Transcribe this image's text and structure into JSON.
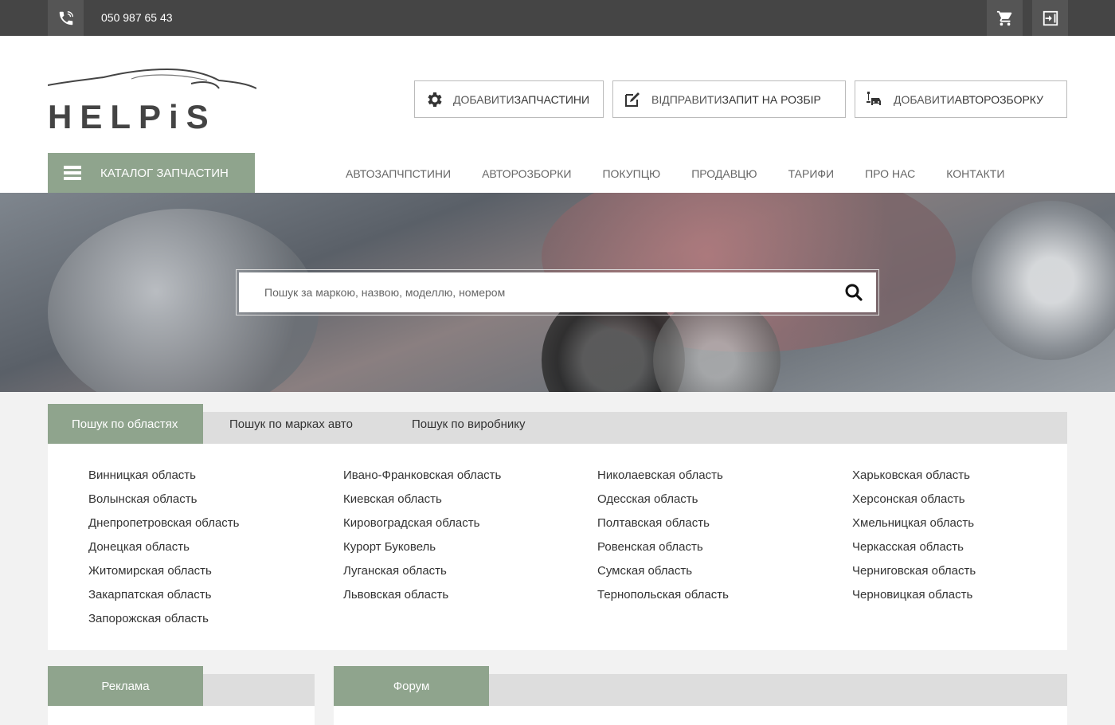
{
  "topbar": {
    "phone": "050 987 65 43",
    "icons": [
      "phone-icon",
      "cart-icon",
      "login-icon"
    ]
  },
  "logo": {
    "text": "HELPiS"
  },
  "actions": [
    {
      "light": "ДОБАВИТИ ",
      "bold": "ЗАПЧАСТИНИ",
      "icon": "gear-icon"
    },
    {
      "light": "ВІДПРАВИТИ ",
      "bold": "ЗАПИТ НА РОЗБІР",
      "icon": "edit-icon"
    },
    {
      "light": "ДОБАВИТИ ",
      "bold": "АВТОРОЗБОРКУ",
      "icon": "car-repair-icon"
    }
  ],
  "catalog": {
    "label": "КАТАЛОГ ЗАПЧАСТИН"
  },
  "nav": [
    "АВТОЗАПЧПСТИНИ",
    "АВТОРОЗБОРКИ",
    "ПОКУПЦЮ",
    "ПРОДАВЦЮ",
    "ТАРИФИ",
    "ПРО НАС",
    "КОНТАКТИ"
  ],
  "search": {
    "placeholder": "Пошук за маркою, назвою, моделлю, номером"
  },
  "tabs": [
    "Пошук по областях",
    "Пошук по марках авто",
    "Пошук по виробнику"
  ],
  "regions": [
    [
      "Винницкая область",
      "Волынская область",
      "Днепропетровская область",
      "Донецкая область",
      "Житомирская область",
      "Закарпатская область",
      "Запорожская область"
    ],
    [
      "Ивано-Франковская область",
      "Киевская область",
      "Кировоградская область",
      "Курорт Буковель",
      "Луганская область",
      "Львовская область"
    ],
    [
      "Николаевская область",
      "Одесская область",
      "Полтавская область",
      "Ровенская область",
      "Сумская область",
      "Тернопольская область"
    ],
    [
      "Харьковская область",
      "Херсонская область",
      "Хмельницкая область",
      "Черкасская область",
      "Черниговская область",
      "Черновицкая область"
    ]
  ],
  "panels": {
    "ads": "Реклама",
    "forum": "Форум"
  },
  "colors": {
    "accent": "#8fa48d",
    "topbar": "#454545"
  }
}
